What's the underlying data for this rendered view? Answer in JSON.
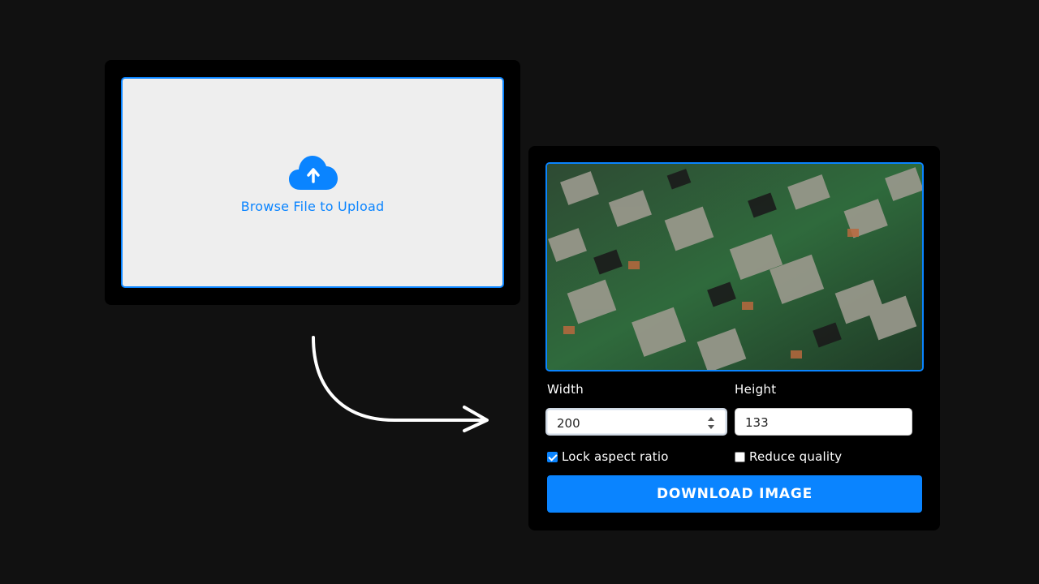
{
  "upload": {
    "label": "Browse File to Upload",
    "icon": "cloud-upload-icon"
  },
  "resizer": {
    "preview_alt": "circuit board photo",
    "width_label": "Width",
    "height_label": "Height",
    "width_value": "200",
    "height_value": "133",
    "lock_aspect_label": "Lock aspect ratio",
    "lock_aspect_checked": true,
    "reduce_quality_label": "Reduce quality",
    "reduce_quality_checked": false,
    "download_label": "DOWNLOAD IMAGE"
  },
  "colors": {
    "accent": "#0a84ff",
    "background": "#111111",
    "panel": "#000000",
    "dropzone": "#eeeeee"
  }
}
